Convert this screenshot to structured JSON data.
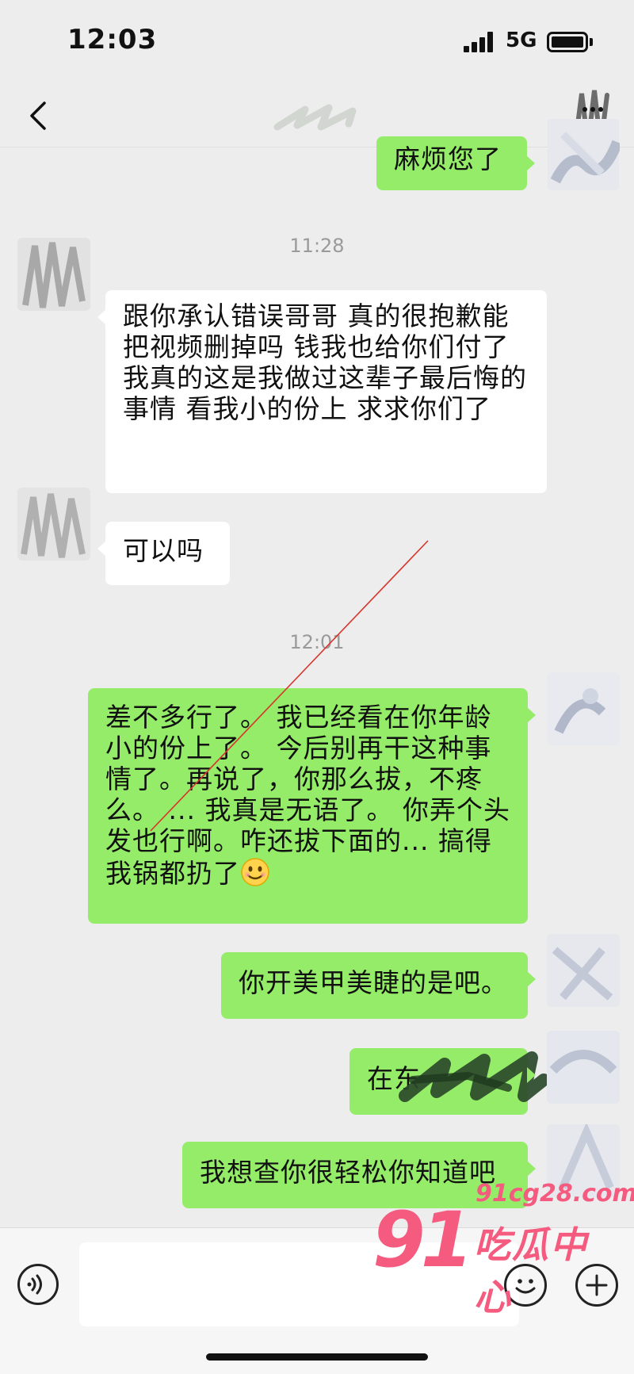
{
  "status_bar": {
    "time": "12:03",
    "network": "5G"
  },
  "colors": {
    "outgoing_bubble": "#95ec69",
    "incoming_bubble": "#ffffff",
    "background": "#ededed",
    "watermark": "#f55a7f"
  },
  "icons": {
    "back": "chevron-left-icon",
    "voice": "voice-icon",
    "emoji": "emoji-icon",
    "plus": "plus-icon"
  },
  "messages": [
    {
      "direction": "out",
      "text": "麻烦您了"
    },
    {
      "type": "time",
      "text": "11:28"
    },
    {
      "direction": "in",
      "text": "跟你承认错误哥哥 真的很抱歉能把视频删掉吗 钱我也给你们付了 我真的这是我做过这辈子最后悔的事情 看我小的份上 求求你们了"
    },
    {
      "direction": "in",
      "text": "可以吗"
    },
    {
      "type": "time",
      "text": "12:01"
    },
    {
      "direction": "out",
      "text": "差不多行了。 我已经看在你年龄小的份上了。 今后别再干这种事情了。再说了，你那么拔，不疼么。 ... 我真是无语了。 你弄个头发也行啊。咋还拔下面的... 搞得我锅都扔了",
      "emoji": "smile-emoji"
    },
    {
      "direction": "out",
      "text": "你开美甲美睫的是吧。"
    },
    {
      "direction": "out",
      "text": "在东"
    },
    {
      "direction": "out",
      "text": "我想查你很轻松你知道吧"
    }
  ],
  "watermark": {
    "number": "91",
    "domain": "91cg28.com",
    "name": "吃瓜中心"
  }
}
